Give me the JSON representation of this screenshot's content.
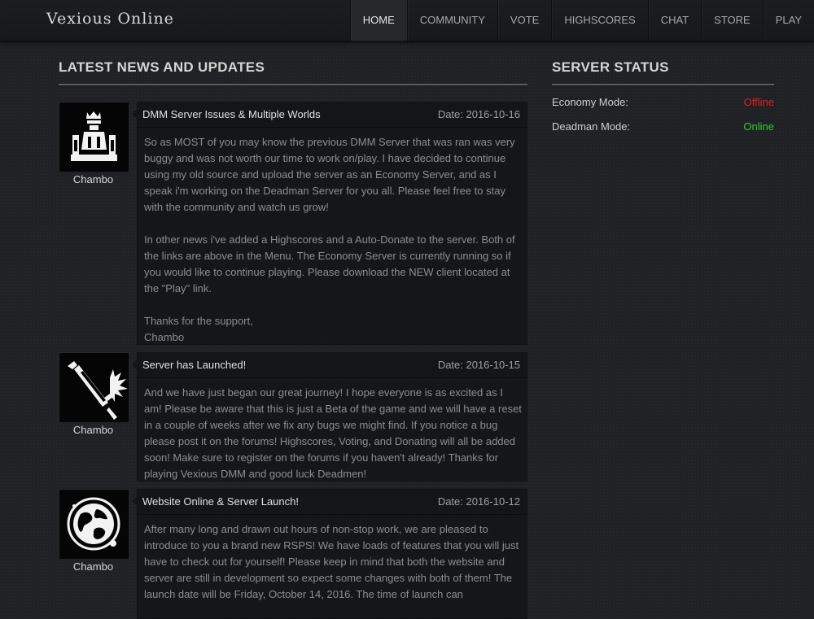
{
  "site": {
    "title": "Vexious Online"
  },
  "nav": {
    "items": [
      {
        "label": "Home"
      },
      {
        "label": "Community"
      },
      {
        "label": "Vote"
      },
      {
        "label": "Highscores"
      },
      {
        "label": "Chat"
      },
      {
        "label": "Store"
      },
      {
        "label": "Play"
      }
    ]
  },
  "news": {
    "heading": "Latest News and Updates",
    "posts": [
      {
        "title": "DMM Server Issues & Multiple Worlds",
        "date": "Date: 2016-10-16",
        "author": "Chambo",
        "icon": "king-throne-icon",
        "paragraphs": [
          "So as MOST of you may know the previous DMM Server that was ran was very buggy and was not worth our time to work on/play. I have decided to continue using my old source and upload the server as an Economy Server, and as I speak i'm working on the Deadman Server for you all. Please feel free to stay with the community and watch us grow!",
          "In other news i've added a Highscores and a Auto-Donate to the server. Both of the links are above in the Menu. The Economy Server is currently running so if you would like to continue playing. Please download the NEW client located at the \"Play\" link.",
          "Thanks for the support,",
          "Chambo"
        ]
      },
      {
        "title": "Server has Launched!",
        "date": "Date: 2016-10-15",
        "author": "Chambo",
        "icon": "sword-strike-icon",
        "paragraphs": [
          "And we have just began our great journey! I hope everyone is as excited as I am! Please be aware that this is just a Beta of the game and we will have a reset in a couple of weeks after we fix any bugs we might find. If you notice a bug please post it on the forums! Highscores, Voting, and Donating will all be added soon! Make sure to register on the forums if you haven't already! Thanks for playing Vexious DMM and good luck Deadmen!"
        ]
      },
      {
        "title": "Website Online & Server Launch!",
        "date": "Date: 2016-10-12",
        "author": "Chambo",
        "icon": "world-globe-icon",
        "paragraphs": [
          "After many long and drawn out hours of non-stop work, we are pleased to introduce to you a brand new RSPS! We have loads of features that you will just have to check out for yourself! Please keep in mind that both the website and server are still in development so expect some changes with both of them! The launch date will be Friday, October 14, 2016. The time of launch can"
        ]
      }
    ]
  },
  "server_status": {
    "heading": "Server Status",
    "rows": [
      {
        "label": "Economy Mode:",
        "value": "Offline",
        "color": "#e02020"
      },
      {
        "label": "Deadman Mode:",
        "value": "Online",
        "color": "#33cc33"
      }
    ]
  }
}
